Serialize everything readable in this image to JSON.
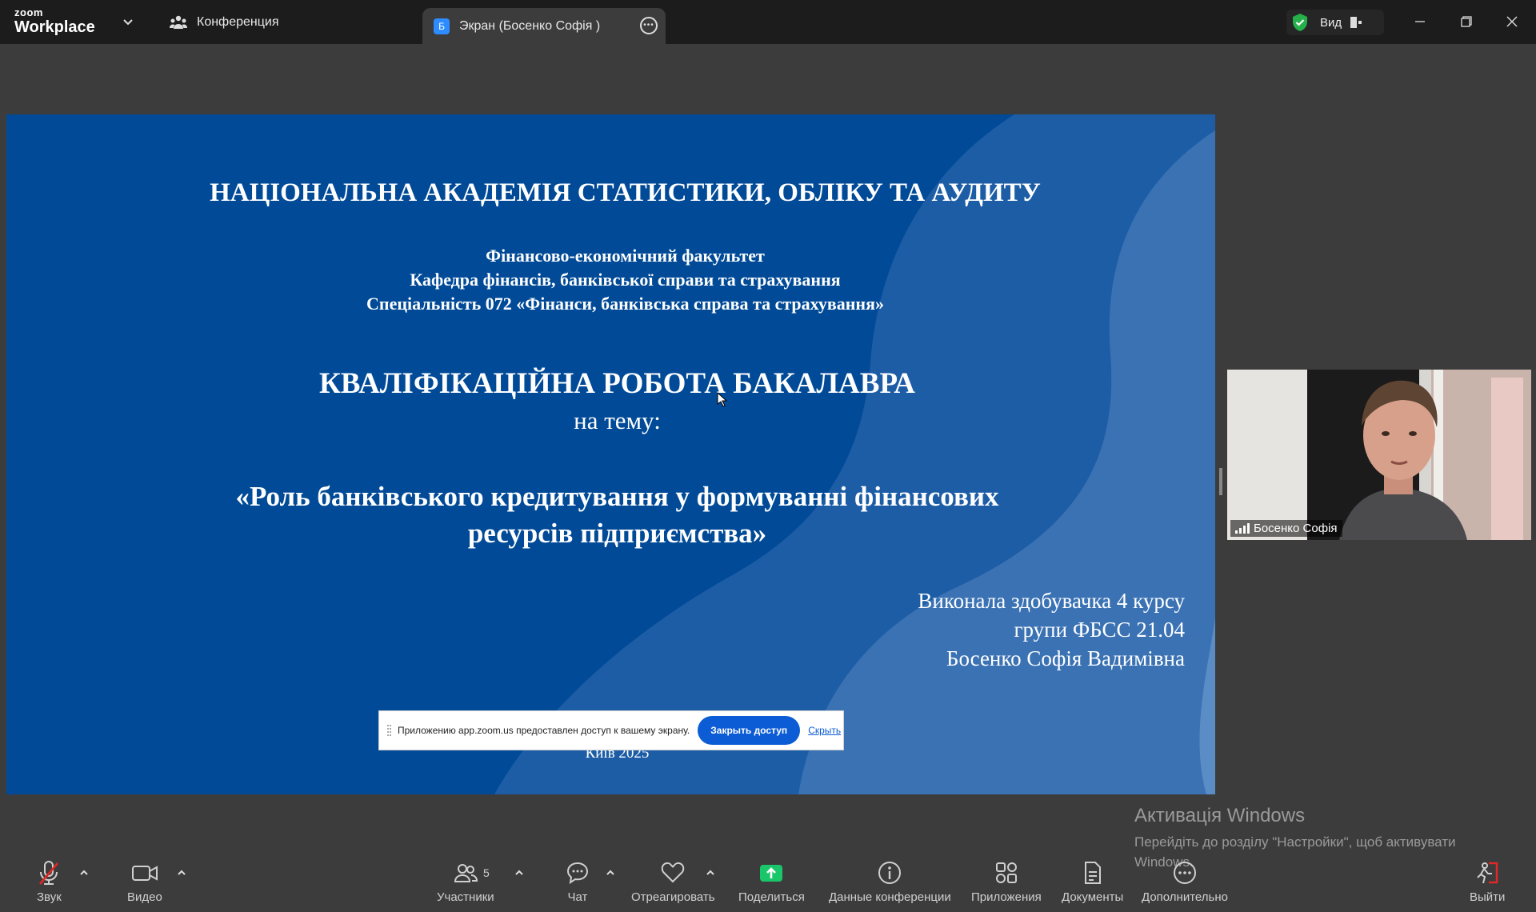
{
  "app": {
    "logo_line1": "zoom",
    "logo_line2": "Workplace"
  },
  "tabs": [
    {
      "label": "Конференция"
    },
    {
      "label": "Экран (Босенко Софія )",
      "badge": "Б"
    }
  ],
  "header": {
    "view_label": "Вид"
  },
  "slide": {
    "academy": "НАЦІОНАЛЬНА АКАДЕМІЯ СТАТИСТИКИ, ОБЛІКУ ТА АУДИТУ",
    "faculty": "Фінансово-економічний факультет",
    "department": "Кафедра фінансів, банківської справи та страхування",
    "specialty": "Спеціальність 072 «Фінанси, банківська справа та страхування»",
    "work_type": "КВАЛІФІКАЦІЙНА РОБОТА БАКАЛАВРА",
    "topic_intro": "на тему:",
    "title_line1": "«Роль банківського кредитування у формуванні фінансових",
    "title_line2": "ресурсів підприємства»",
    "author_line1": "Виконала  здобувачка 4 курсу",
    "author_line2": "групи ФБСС 21.04",
    "author_line3": "Босенко  Софія Вадимівна",
    "city_year": "Київ 2025"
  },
  "share_notice": {
    "text": "Приложению app.zoom.us предоставлен доступ к вашему экрану.",
    "stop_button": "Закрыть доступ",
    "hide_link": "Скрыть"
  },
  "video": {
    "participant_name": "Босенко Софія"
  },
  "watermark": {
    "title": "Активація Windows",
    "subtitle": "Перейдіть до розділу \"Настройки\", щоб активувати Windows."
  },
  "toolbar": {
    "audio": "Звук",
    "video": "Видео",
    "participants": "Участники",
    "participants_count": "5",
    "chat": "Чат",
    "react": "Отреагировать",
    "share": "Поделиться",
    "meeting_info": "Данные конференции",
    "apps": "Приложения",
    "docs": "Документы",
    "more": "Дополнительно",
    "leave": "Выйти"
  },
  "colors": {
    "slide_blue": "#004a97",
    "share_green": "#19c66a",
    "leave_red": "#e02828",
    "accent_blue": "#0b5cd5"
  }
}
